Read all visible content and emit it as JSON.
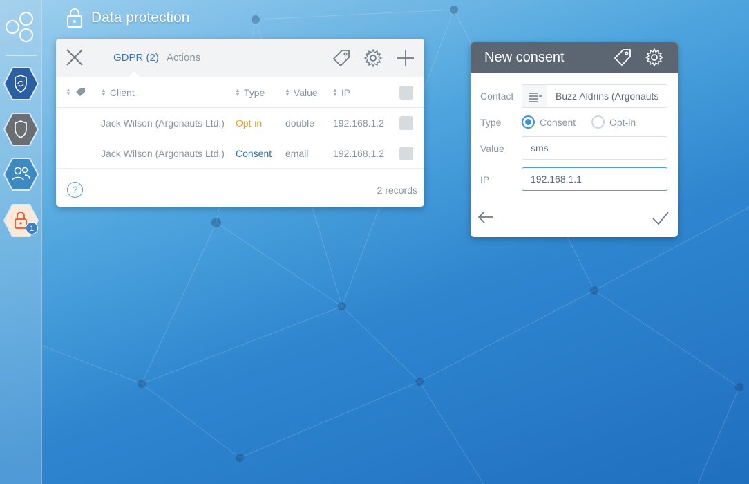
{
  "app": {
    "title": "Data protection"
  },
  "sidebar": {
    "items": [
      {
        "name": "sync-shield",
        "icon": "shield-sync-icon"
      },
      {
        "name": "shield",
        "icon": "shield-icon"
      },
      {
        "name": "users",
        "icon": "users-icon"
      },
      {
        "name": "data-protection",
        "icon": "lock-icon",
        "badge": "1"
      }
    ]
  },
  "gdpr_panel": {
    "tabs": [
      {
        "label": "GDPR (2)",
        "active": true
      },
      {
        "label": "Actions",
        "active": false
      }
    ],
    "columns": {
      "client": "Client",
      "type": "Type",
      "value": "Value",
      "ip": "IP"
    },
    "rows": [
      {
        "client": "Jack Wilson (Argonauts Ltd.)",
        "type": "Opt-in",
        "value": "double",
        "ip": "192.168.1.2"
      },
      {
        "client": "Jack Wilson (Argonauts Ltd.)",
        "type": "Consent",
        "value": "email",
        "ip": "192.168.1.2"
      }
    ],
    "help_label": "?",
    "records": "2 records"
  },
  "consent_panel": {
    "title": "New consent",
    "contact_label": "Contact",
    "contact_value": "Buzz Aldrins (Argonauts",
    "type_label": "Type",
    "type_options": [
      {
        "label": "Consent",
        "selected": true
      },
      {
        "label": "Opt-in",
        "selected": false
      }
    ],
    "value_label": "Value",
    "value_value": "sms",
    "ip_label": "IP",
    "ip_value": "192.168.1.1"
  },
  "colors": {
    "accent": "#3b74b8",
    "optin": "#e0a22a",
    "consent": "#3b6fa8",
    "panel_header": "#5c6673"
  }
}
